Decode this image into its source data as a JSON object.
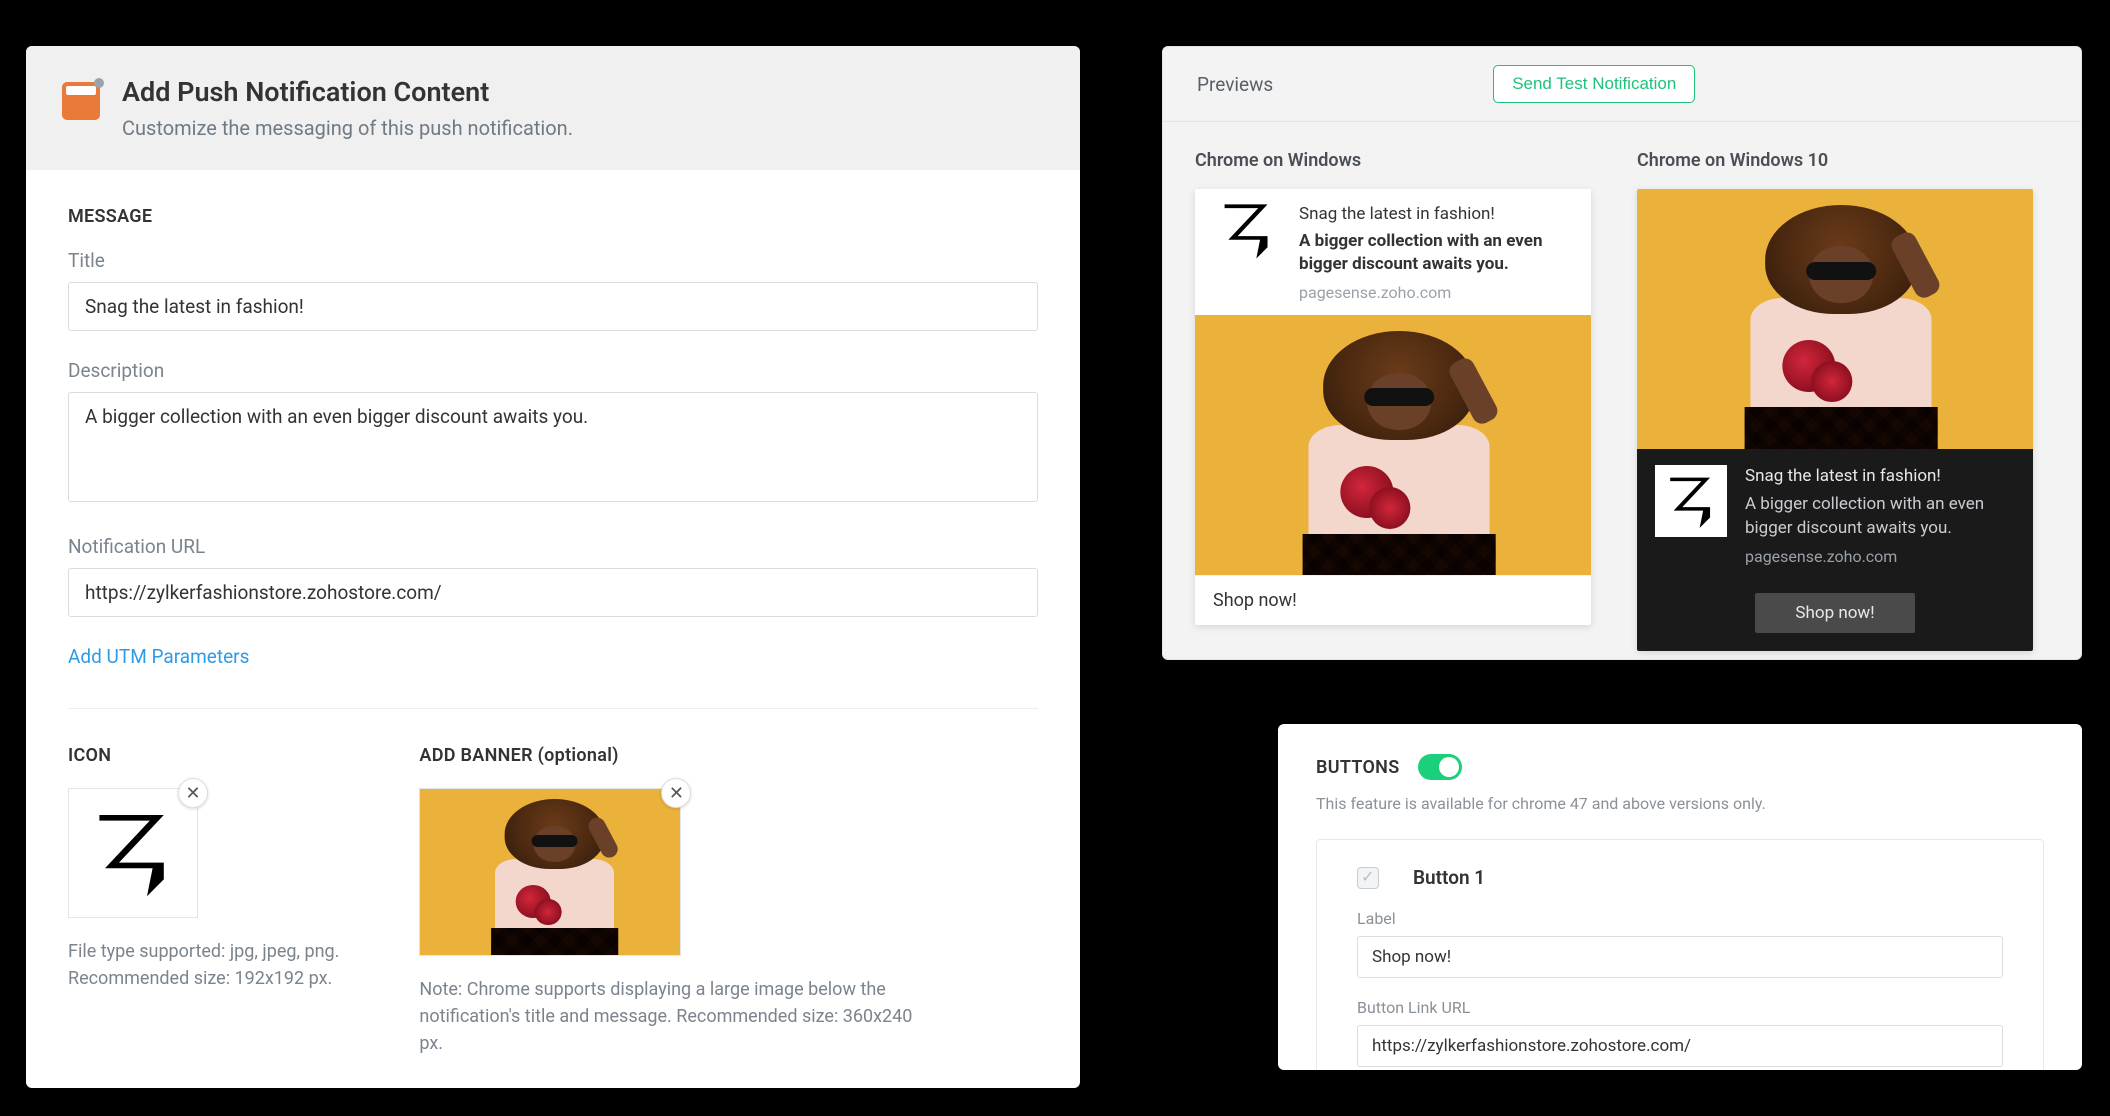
{
  "header": {
    "title": "Add Push Notification Content",
    "subtitle": "Customize the messaging of this push notification."
  },
  "message": {
    "section": "MESSAGE",
    "title_label": "Title",
    "title_value": "Snag the latest in fashion!",
    "desc_label": "Description",
    "desc_value": "A bigger collection with an even bigger discount awaits you.",
    "url_label": "Notification URL",
    "url_value": "https://zylkerfashionstore.zohostore.com/",
    "utm_link": "Add UTM Parameters"
  },
  "media": {
    "icon_section": "ICON",
    "icon_hint1": "File type supported: jpg, jpeg, png.",
    "icon_hint2": "Recommended size: 192x192 px.",
    "banner_section": "ADD BANNER (optional)",
    "banner_hint": "Note: Chrome supports displaying a large image below the notification's title and message. Recommended size: 360x240 px."
  },
  "previews": {
    "header": "Previews",
    "send_btn": "Send Test Notification",
    "col1_title": "Chrome on Windows",
    "col2_title": "Chrome on Windows 10",
    "notif_title": "Snag the latest in fashion!",
    "notif_desc": "A bigger collection with an even bigger discount awaits you.",
    "notif_domain": "pagesense.zoho.com",
    "notif_action": "Shop now!"
  },
  "buttons": {
    "section": "BUTTONS",
    "hint": "This feature is available for chrome 47 and above versions only.",
    "button1": {
      "header": "Button 1",
      "label_label": "Label",
      "label_value": "Shop now!",
      "url_label": "Button Link URL",
      "url_value": "https://zylkerfashionstore.zohostore.com/"
    }
  }
}
